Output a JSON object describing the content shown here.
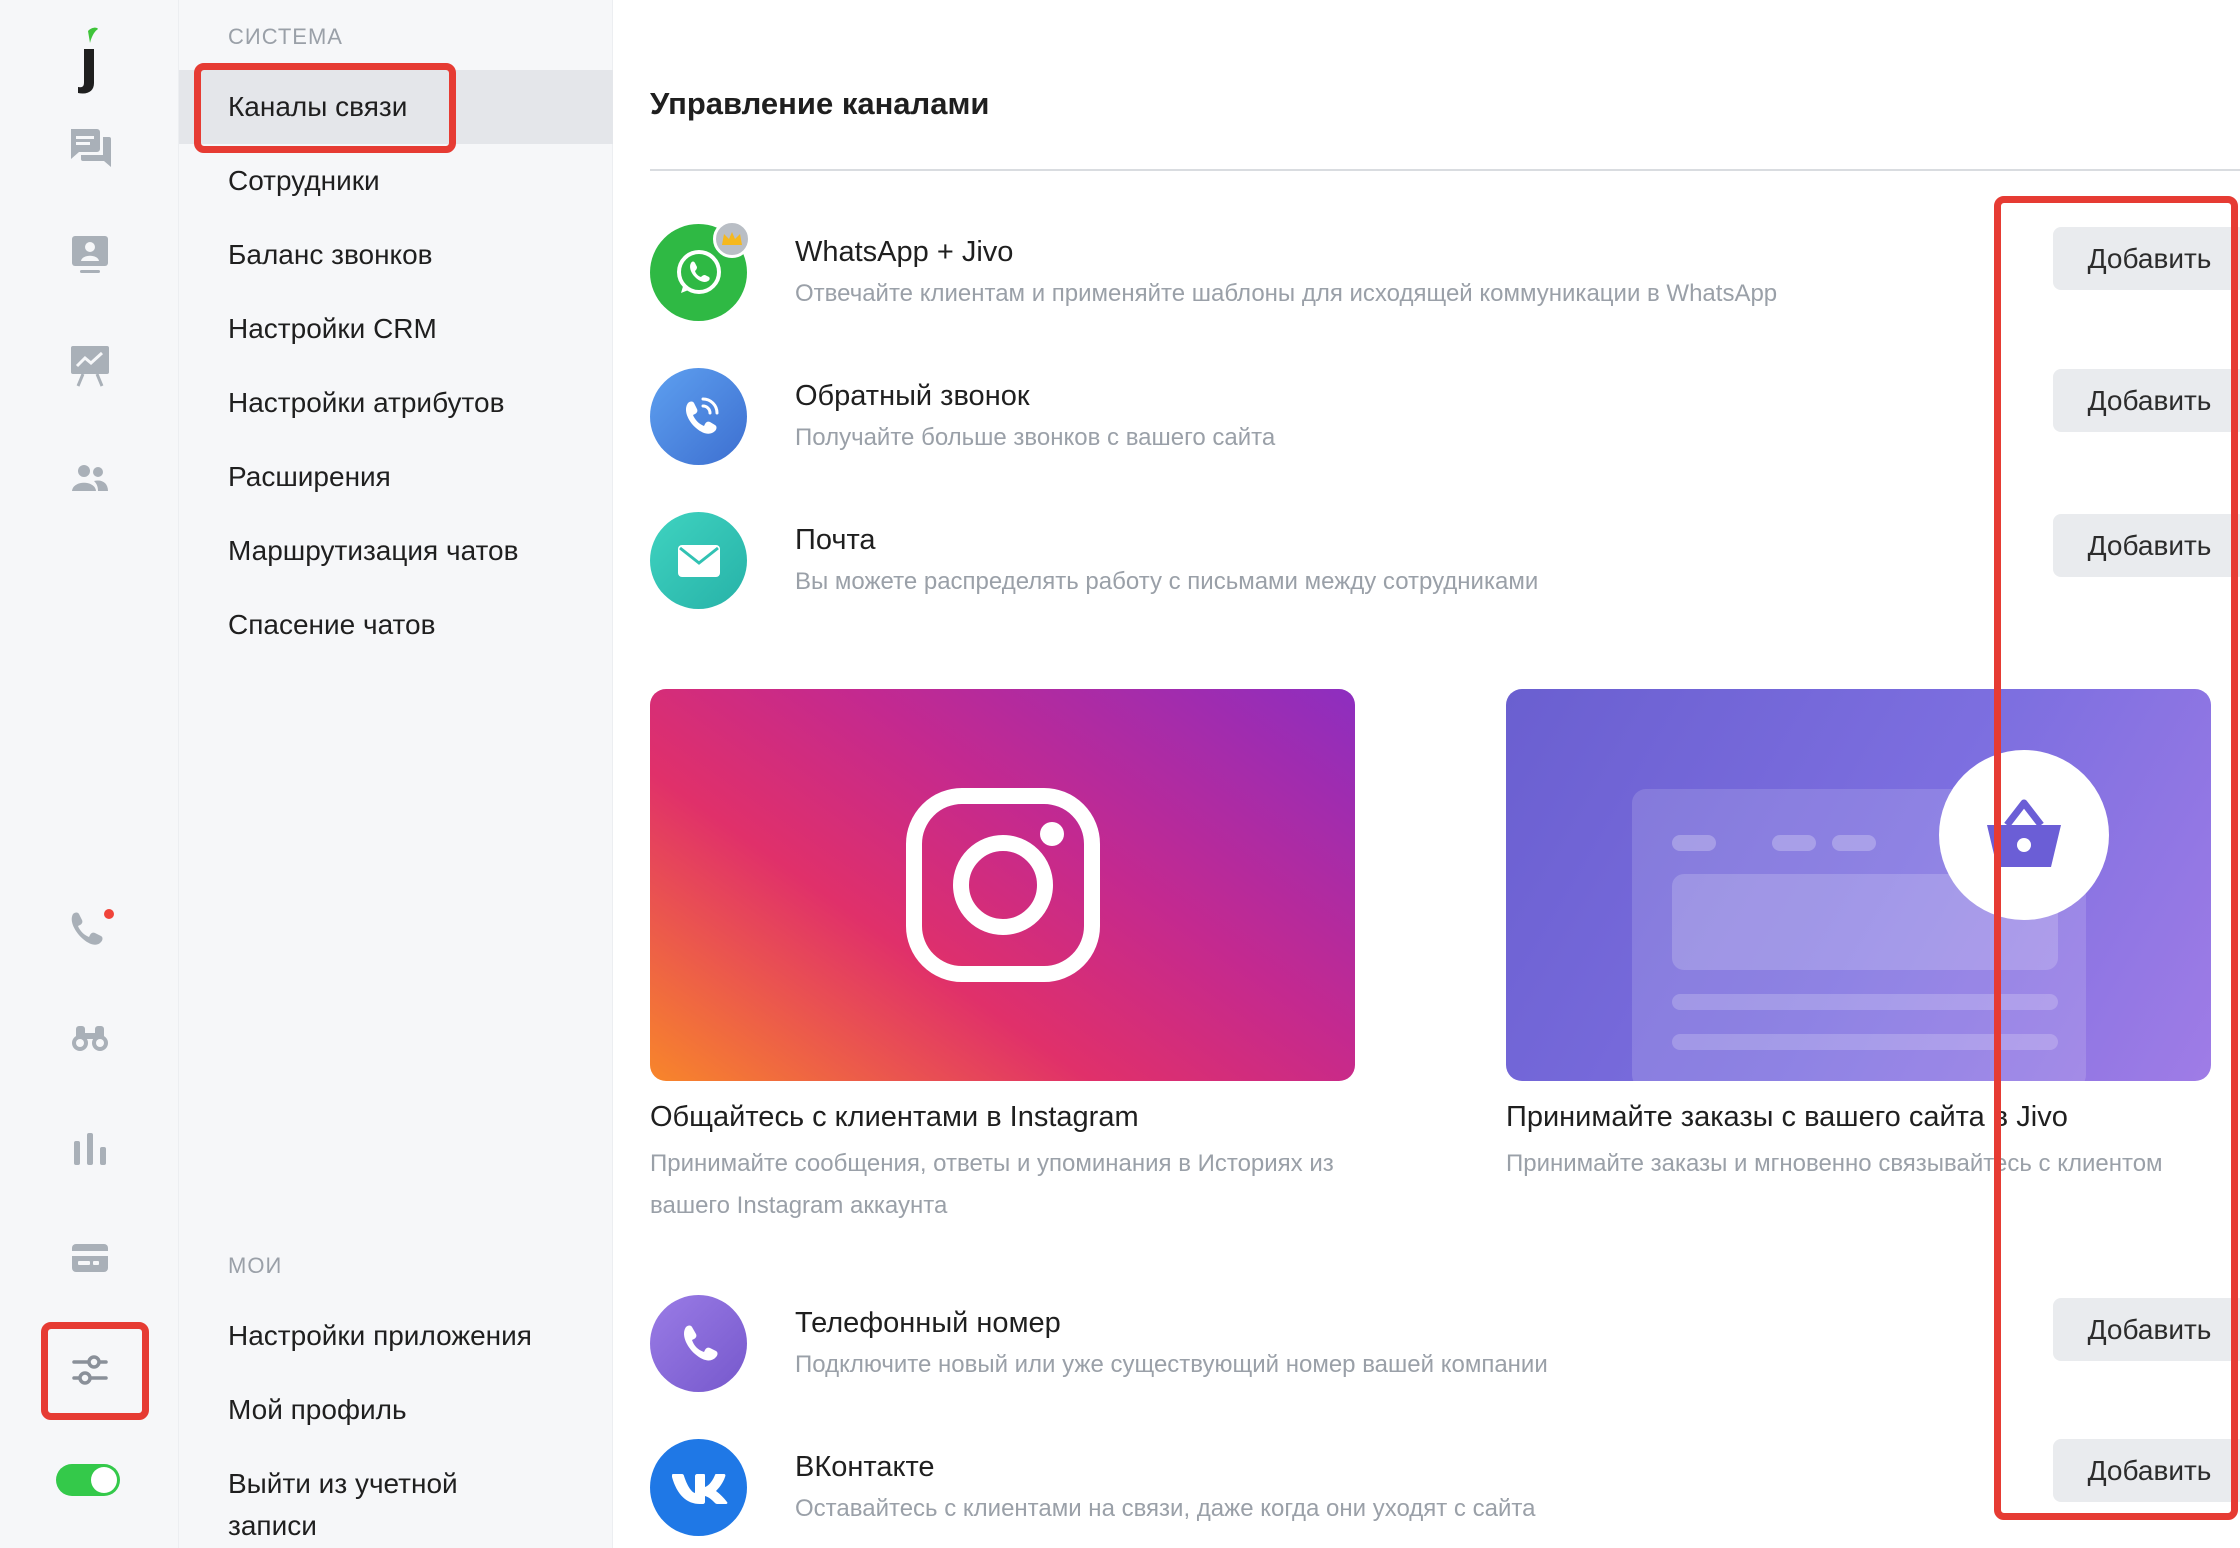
{
  "rail": {
    "logo_letter": "j",
    "items": [
      {
        "icon": "chats-icon"
      },
      {
        "icon": "visitors-icon"
      },
      {
        "icon": "reports-board-icon"
      },
      {
        "icon": "team-icon"
      },
      {
        "icon": "phone-icon",
        "badge_color": "#f0443a"
      },
      {
        "icon": "binoculars-icon"
      },
      {
        "icon": "analytics-bars-icon"
      },
      {
        "icon": "billing-card-icon"
      },
      {
        "icon": "settings-sliders-icon"
      }
    ],
    "status_toggle_on": true,
    "toggle_color": "#34c94a"
  },
  "nav": {
    "system_heading": "СИСТЕМА",
    "system_items": [
      {
        "label": "Каналы связи",
        "active": true
      },
      {
        "label": "Сотрудники"
      },
      {
        "label": "Баланс звонков"
      },
      {
        "label": "Настройки CRM"
      },
      {
        "label": "Настройки атрибутов"
      },
      {
        "label": "Расширения"
      },
      {
        "label": "Маршрутизация чатов"
      },
      {
        "label": "Спасение чатов"
      }
    ],
    "my_heading": "МОИ",
    "my_items": [
      {
        "label": "Настройки приложения"
      },
      {
        "label": "Мой профиль"
      },
      {
        "label": "Выйти из учетной записи"
      }
    ]
  },
  "main": {
    "title": "Управление каналами",
    "add_label": "Добавить",
    "channels_top": [
      {
        "title": "WhatsApp + Jivo",
        "desc": "Отвечайте клиентам и применяйте шаблоны для исходящей коммуникации в WhatsApp",
        "icon": "whatsapp-icon",
        "color": "#2fb944"
      },
      {
        "title": "Обратный звонок",
        "desc": "Получайте больше звонков с вашего сайта",
        "icon": "callback-icon",
        "color": "#4a86e0"
      },
      {
        "title": "Почта",
        "desc": "Вы можете распределять работу с письмами между сотрудниками",
        "icon": "mail-icon",
        "color": "#31c2b3"
      }
    ],
    "promos": [
      {
        "title": "Общайтесь с клиентами в Instagram",
        "desc": "Принимайте сообщения, ответы и упоминания в Историях из вашего Instagram аккаунта",
        "icon": "instagram-icon"
      },
      {
        "title": "Принимайте заказы с вашего сайта в Jivo",
        "desc": "Принимайте заказы и мгновенно связывайтесь с клиентом",
        "icon": "shopping-basket-icon"
      }
    ],
    "channels_bottom": [
      {
        "title": "Телефонный номер",
        "desc": "Подключите новый или уже существующий номер вашей компании",
        "icon": "phone-number-icon",
        "color": "#8a68d8"
      },
      {
        "title": "ВКонтакте",
        "desc": "Оставайтесь с клиентами на связи, даже когда они уходят с сайта",
        "icon": "vk-icon",
        "color": "#1f78e6"
      }
    ]
  },
  "highlight_color": "#e63b33"
}
